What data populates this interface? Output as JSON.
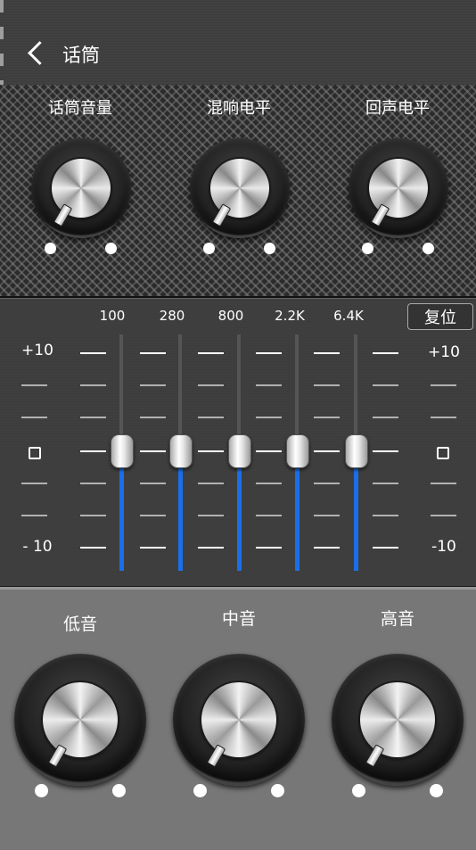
{
  "header": {
    "title": "话筒"
  },
  "mic_knobs": [
    {
      "label": "话筒音量"
    },
    {
      "label": "混响电平"
    },
    {
      "label": "回声电平"
    }
  ],
  "eq": {
    "reset_label": "复位",
    "frequencies": [
      "100",
      "280",
      "800",
      "2.2K",
      "6.4K"
    ],
    "scale": {
      "top": "+10",
      "middle": "0",
      "bottom": "- 10",
      "top_right": "+10",
      "bottom_right": "-10"
    },
    "band_values": [
      0,
      0,
      0,
      0,
      0
    ],
    "accent_color": "#1a6fe8"
  },
  "tone_knobs": [
    {
      "label": "低音"
    },
    {
      "label": "中音"
    },
    {
      "label": "高音"
    }
  ]
}
